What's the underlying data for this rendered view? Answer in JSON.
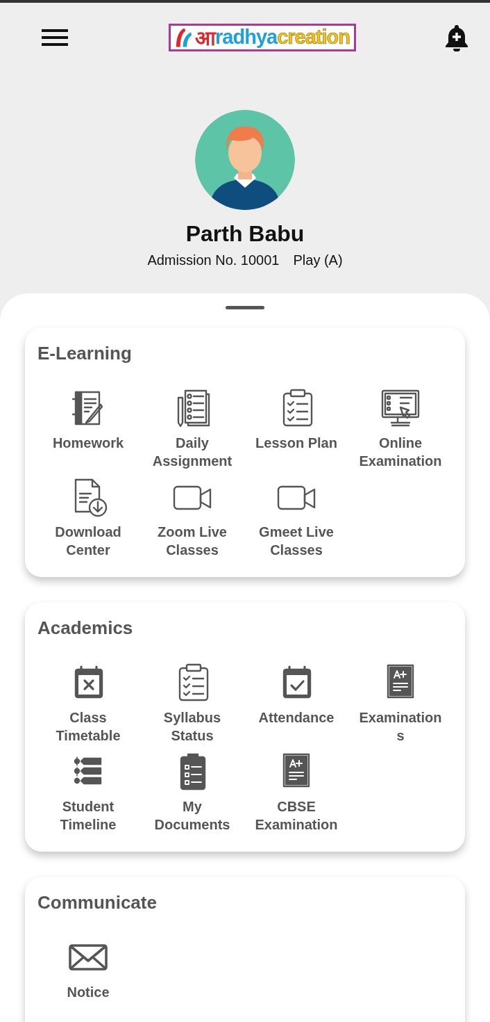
{
  "header": {
    "logo": {
      "mark": "आ",
      "name": "radhya",
      "suffix": "creation"
    }
  },
  "profile": {
    "name": "Parth Babu",
    "admission": "Admission No. 10001",
    "class": "Play (A)"
  },
  "sections": [
    {
      "title": "E-Learning",
      "items": [
        {
          "kind": "notebook",
          "lines": [
            "Homework"
          ]
        },
        {
          "kind": "checklist",
          "lines": [
            "Daily",
            "Assignment"
          ]
        },
        {
          "kind": "clipboard",
          "lines": [
            "Lesson Plan"
          ]
        },
        {
          "kind": "monitor",
          "lines": [
            "Online",
            "Examination"
          ]
        },
        {
          "kind": "download",
          "lines": [
            "Download",
            "Center"
          ]
        },
        {
          "kind": "video",
          "lines": [
            "Zoom Live",
            "Classes"
          ]
        },
        {
          "kind": "video",
          "lines": [
            "Gmeet Live",
            "Classes"
          ]
        }
      ]
    },
    {
      "title": "Academics",
      "items": [
        {
          "kind": "calendar-x",
          "lines": [
            "Class",
            "Timetable"
          ]
        },
        {
          "kind": "clipboard",
          "lines": [
            "Syllabus",
            "Status"
          ]
        },
        {
          "kind": "calendar-check",
          "lines": [
            "Attendance"
          ]
        },
        {
          "kind": "grade",
          "lines": [
            "Examination",
            "s"
          ]
        },
        {
          "kind": "timeline",
          "lines": [
            "Student",
            "Timeline"
          ]
        },
        {
          "kind": "documents",
          "lines": [
            "My",
            "Documents"
          ]
        },
        {
          "kind": "grade",
          "lines": [
            "CBSE",
            "Examination"
          ]
        }
      ]
    },
    {
      "title": "Communicate",
      "items": [
        {
          "kind": "envelope",
          "lines": [
            "Notice"
          ]
        }
      ]
    }
  ]
}
